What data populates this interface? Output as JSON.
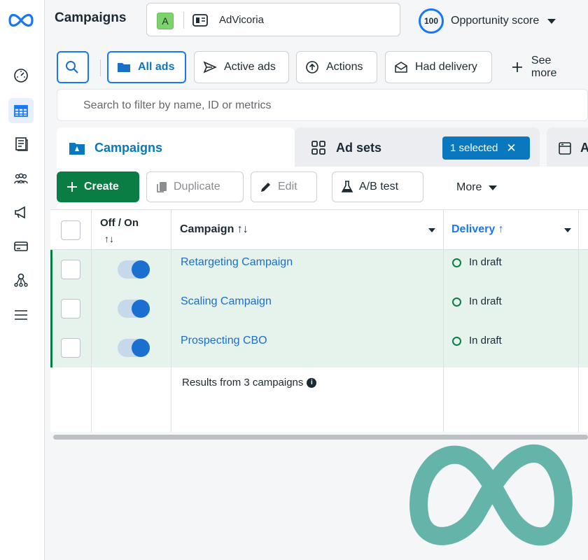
{
  "app": {
    "title": "Campaigns"
  },
  "account": {
    "initial": "A",
    "name": "AdVicoria"
  },
  "opportunity": {
    "score": "100",
    "label": "Opportunity score"
  },
  "filters": {
    "all_ads": "All ads",
    "active_ads": "Active ads",
    "actions": "Actions",
    "had_delivery": "Had delivery",
    "see_more": "See more"
  },
  "search": {
    "placeholder": "Search to filter by name, ID or metrics"
  },
  "tabs": {
    "campaigns": "Campaigns",
    "ad_sets": "Ad sets",
    "selected": "1 selected",
    "ads_partial": "A"
  },
  "toolbar": {
    "create": "Create",
    "duplicate": "Duplicate",
    "edit": "Edit",
    "ab_test": "A/B test",
    "more": "More"
  },
  "table": {
    "headers": {
      "off_on": "Off / On",
      "off_on_sort": "↑↓",
      "campaign": "Campaign ↑↓",
      "delivery": "Delivery ↑"
    },
    "rows": [
      {
        "name": "Retargeting Campaign",
        "delivery": "In draft",
        "on": true
      },
      {
        "name": "Scaling Campaign",
        "delivery": "In draft",
        "on": true
      },
      {
        "name": "Prospecting CBO",
        "delivery": "In draft",
        "on": true
      }
    ],
    "results": "Results from 3 campaigns"
  },
  "colors": {
    "brand_blue": "#1877f2",
    "create_green": "#0a7d45",
    "row_highlight": "#e6f2ec",
    "meta_watermark": "#64b4aa"
  },
  "icons": [
    "meta-logo-icon",
    "dashboard-icon",
    "table-icon",
    "book-icon",
    "people-icon",
    "megaphone-icon",
    "card-icon",
    "graph-icon",
    "menu-icon",
    "search-icon",
    "folder-icon",
    "send-icon",
    "actions-icon",
    "envelope-icon",
    "plus-icon",
    "grid-icon",
    "copy-icon",
    "pencil-icon",
    "flask-icon",
    "info-icon"
  ]
}
